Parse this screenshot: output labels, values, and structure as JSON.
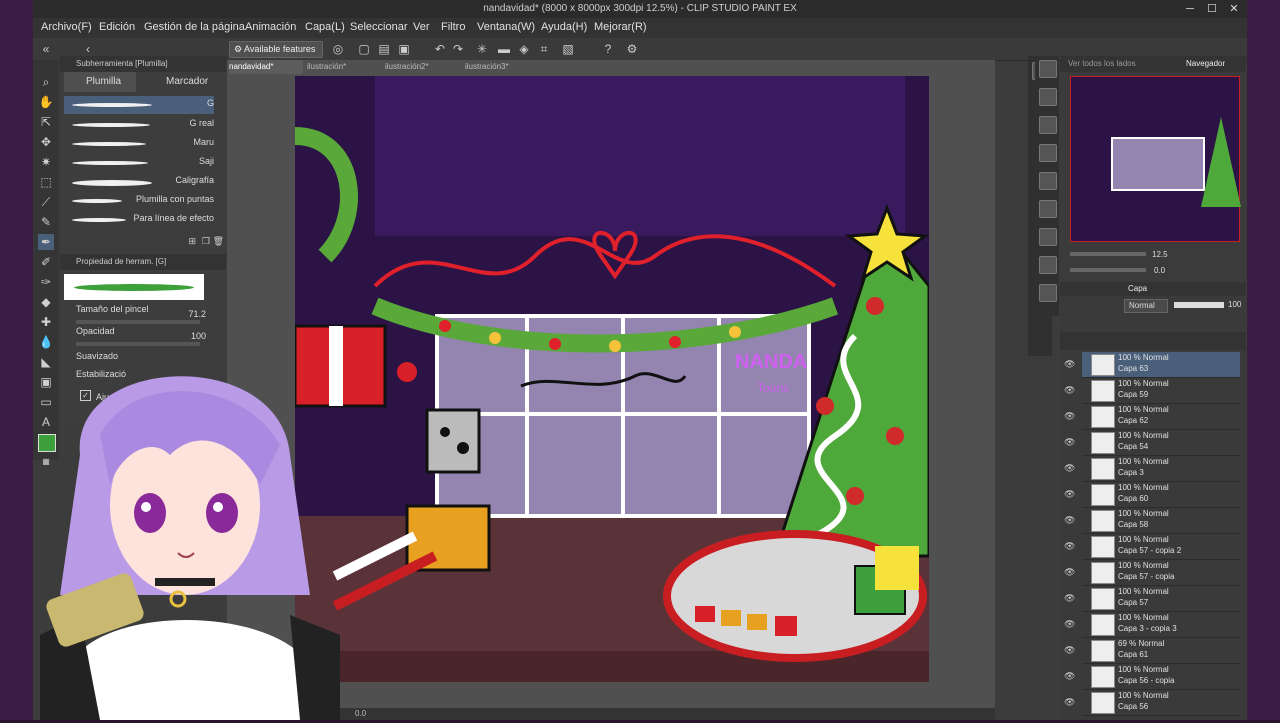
{
  "window": {
    "title": "nandavidad* (8000 x 8000px 300dpi 12.5%)  - CLIP STUDIO PAINT EX",
    "controls": [
      "─",
      "☐",
      "✕"
    ]
  },
  "menu": [
    "Archivo(F)",
    "Edición",
    "Gestión de la página",
    "Animación",
    "Capa(L)",
    "Seleccionar",
    "Ver",
    "Filtro",
    "Ventana(W)",
    "Ayuda(H)",
    "Mejorar(R)"
  ],
  "commandbar": {
    "available_features": "Available features"
  },
  "subtool": {
    "header": "Subherramienta [Plumilla]",
    "tabs": [
      "Plumilla",
      "Marcador"
    ],
    "brushes": [
      "G",
      "G real",
      "Maru",
      "Saji",
      "Caligrafía",
      "Plumilla con puntas",
      "Para línea de efecto"
    ]
  },
  "toolprop": {
    "header": "Propiedad de herram. [G]",
    "brush_size_label": "Tamaño del pincel",
    "brush_size": "71.2",
    "opacity_label": "Opacidad",
    "opacity": "100",
    "smoothing_label": "Suavizado",
    "stabilization_label": "Estabilizació",
    "adjust_label": "Aju"
  },
  "doc_tabs": [
    "nandavidad*",
    "ilustración*",
    "ilustración2*",
    "ilustración3*"
  ],
  "navigator": {
    "tabs": [
      "Ver todos los lados",
      "Navegador"
    ],
    "zoom": "12.5",
    "rotation": "0.0"
  },
  "layers": {
    "tab": "Capa",
    "blend_mode": "Normal",
    "opacity": "100",
    "items": [
      {
        "mode": "100 % Normal",
        "name": "Capa 63",
        "selected": true
      },
      {
        "mode": "100 % Normal",
        "name": "Capa 59"
      },
      {
        "mode": "100 % Normal",
        "name": "Capa 62"
      },
      {
        "mode": "100 % Normal",
        "name": "Capa 54"
      },
      {
        "mode": "100 % Normal",
        "name": "Capa 3"
      },
      {
        "mode": "100 % Normal",
        "name": "Capa 60"
      },
      {
        "mode": "100 % Normal",
        "name": "Capa 58"
      },
      {
        "mode": "100 % Normal",
        "name": "Capa 57 - copia 2"
      },
      {
        "mode": "100 % Normal",
        "name": "Capa 57 - copia"
      },
      {
        "mode": "100 % Normal",
        "name": "Capa 57"
      },
      {
        "mode": "100 % Normal",
        "name": "Capa 3 - copia 3"
      },
      {
        "mode": "69 % Normal",
        "name": "Capa 61"
      },
      {
        "mode": "100 % Normal",
        "name": "Capa 56 - copia"
      },
      {
        "mode": "100 % Normal",
        "name": "Capa 56"
      }
    ]
  },
  "canvas": {
    "sign_text_1": "NANDA",
    "sign_text_2": "Toons"
  },
  "status": {
    "zoom": "0.0"
  },
  "colors": {
    "accent": "#4a5f7a",
    "tree": "#4fa83a",
    "ribbon": "#e0202a",
    "star": "#f6e23a",
    "wall": "#2b1346"
  }
}
